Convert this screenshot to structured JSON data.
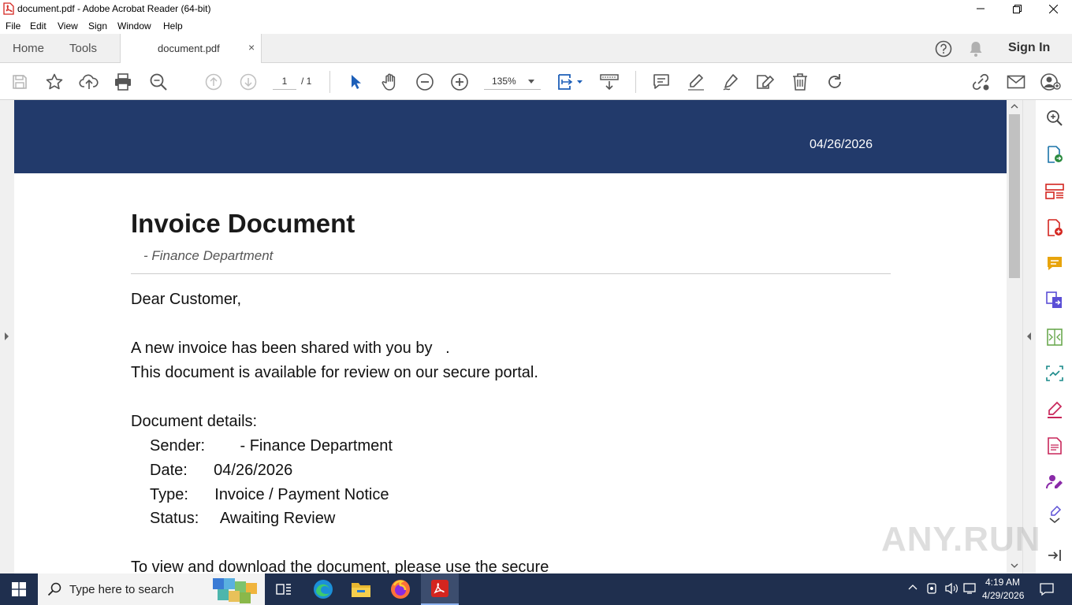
{
  "window": {
    "title": "document.pdf - Adobe Acrobat Reader (64-bit)"
  },
  "menu": [
    "File",
    "Edit",
    "View",
    "Sign",
    "Window",
    "Help"
  ],
  "tabs": {
    "home": "Home",
    "tools": "Tools",
    "document": "document.pdf",
    "close_symbol": "×"
  },
  "account": {
    "sign_in": "Sign In"
  },
  "toolbar": {
    "page_current": "1",
    "page_total": "/ 1",
    "zoom": "135%",
    "icons": [
      "save-icon",
      "star-icon",
      "upload-icon",
      "print-icon",
      "search-zoom-icon",
      "prev-page-icon",
      "next-page-icon",
      "select-cursor-icon",
      "hand-icon",
      "zoom-out-icon",
      "zoom-in-icon",
      "page-fit-icon",
      "read-mode-icon",
      "comment-icon",
      "highlight-icon",
      "draw-icon",
      "fill-sign-icon",
      "delete-icon",
      "rotate-icon",
      "share-link-icon",
      "email-icon",
      "account-icon"
    ]
  },
  "document": {
    "banner_date": "04/26/2026",
    "title": "Invoice Document",
    "subtitle": "- Finance Department",
    "greeting": "Dear Customer,",
    "line1": "A new invoice has been shared with you by   .",
    "line2": "This document is available for review on our secure portal.",
    "details_heading": "Document details:",
    "details": [
      "Sender:        - Finance Department",
      "Date:      04/26/2026",
      "Type:      Invoice / Payment Notice",
      "Status:     Awaiting Review"
    ],
    "line_last": "To view and download the document, please use the secure"
  },
  "watermark": "ANY.RUN",
  "taskbar": {
    "search_placeholder": "Type here to search",
    "time": "4:19 AM",
    "date": "4/29/2026"
  },
  "colors": {
    "banner": "#223a6b",
    "taskbar": "#1f2f4e",
    "acrobat_red": "#d4251f",
    "right_panel_icons": [
      "#1a73a8",
      "#2a8a3e",
      "#d4251f",
      "#e8a40c",
      "#5b4fd6",
      "#6aa84f",
      "#1a8a8a",
      "#c8265a",
      "#c8265a",
      "#8a2aa8",
      "#5b4fd6"
    ]
  }
}
